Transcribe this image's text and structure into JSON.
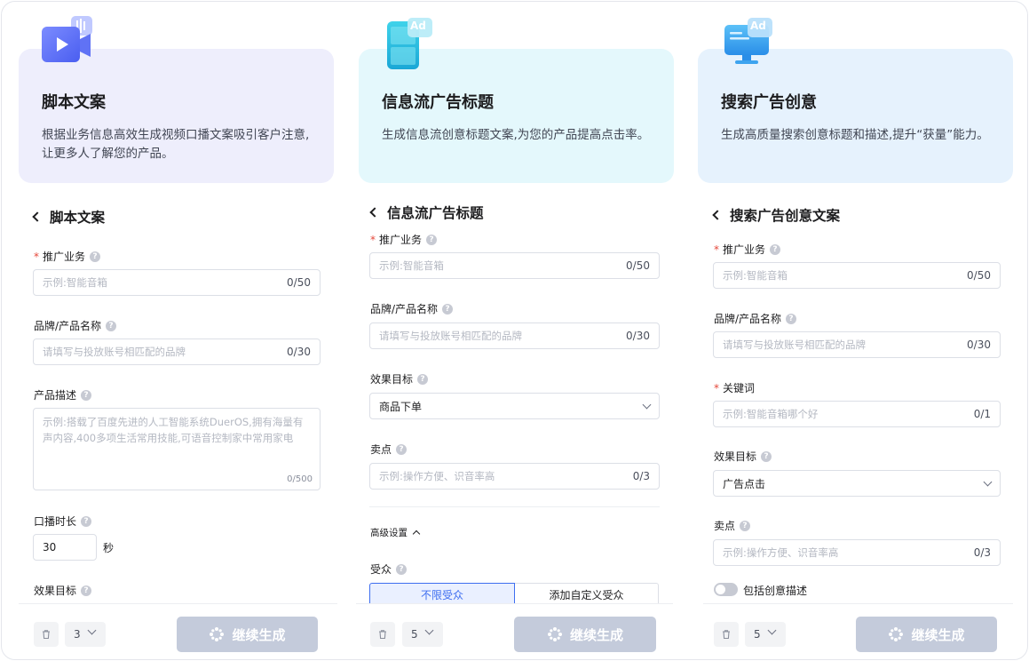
{
  "columns": [
    {
      "hero_title": "脚本文案",
      "hero_desc": "根据业务信息高效生成视频口播文案吸引客户注意,让更多人了解您的产品。",
      "form_title": "脚本文案",
      "fields": {
        "business_label": "推广业务",
        "business_placeholder": "示例:智能音箱",
        "business_count": "0/50",
        "brand_label": "品牌/产品名称",
        "brand_placeholder": "请填写与投放账号相匹配的品牌",
        "brand_count": "0/30",
        "desc_label": "产品描述",
        "desc_placeholder": "示例:搭载了百度先进的人工智能系统DuerOS,拥有海量有声内容,400多项生活常用技能,可语音控制家中常用家电",
        "desc_count": "0/500",
        "duration_label": "口播时长",
        "duration_value": "30",
        "duration_unit": "秒",
        "goal_label": "效果目标"
      },
      "footer": {
        "count": "3",
        "generate_label": "继续生成"
      }
    },
    {
      "hero_title": "信息流广告标题",
      "hero_desc": "生成信息流创意标题文案,为您的产品提高点击率。",
      "form_title": "信息流广告标题",
      "fields": {
        "business_label": "推广业务",
        "business_placeholder": "示例:智能音箱",
        "business_count": "0/50",
        "brand_label": "品牌/产品名称",
        "brand_placeholder": "请填写与投放账号相匹配的品牌",
        "brand_count": "0/30",
        "goal_label": "效果目标",
        "goal_value": "商品下单",
        "selling_label": "卖点",
        "selling_placeholder": "示例:操作方便、识音率高",
        "selling_count": "0/3",
        "advanced_label": "高级设置",
        "audience_label": "受众",
        "audience_tab_all": "不限受众",
        "audience_tab_custom": "添加自定义受众"
      },
      "footer": {
        "count": "5",
        "generate_label": "继续生成"
      }
    },
    {
      "hero_title": "搜索广告创意",
      "hero_desc": "生成高质量搜索创意标题和描述,提升“获量”能力。",
      "form_title": "搜索广告创意文案",
      "fields": {
        "business_label": "推广业务",
        "business_placeholder": "示例:智能音箱",
        "business_count": "0/50",
        "brand_label": "品牌/产品名称",
        "brand_placeholder": "请填写与投放账号相匹配的品牌",
        "brand_count": "0/30",
        "keyword_label": "关键词",
        "keyword_placeholder": "示例:智能音箱哪个好",
        "keyword_count": "0/1",
        "goal_label": "效果目标",
        "goal_value": "广告点击",
        "selling_label": "卖点",
        "selling_placeholder": "示例:操作方便、识音率高",
        "selling_count": "0/3",
        "include_desc_label": "包括创意描述"
      },
      "footer": {
        "count": "5",
        "generate_label": "继续生成"
      }
    }
  ],
  "icons": {
    "hero1": "video-icon",
    "hero2": "mobile-ad-icon",
    "hero3": "monitor-ad-icon",
    "ad_badge_text": "Ad"
  },
  "colors": {
    "hero1_bg": "#eeeefc",
    "hero2_bg": "#e4f8fc",
    "hero3_bg": "#e6f2fd",
    "accent": "#3e6ef0",
    "button_disabled": "#c4cbdb"
  }
}
